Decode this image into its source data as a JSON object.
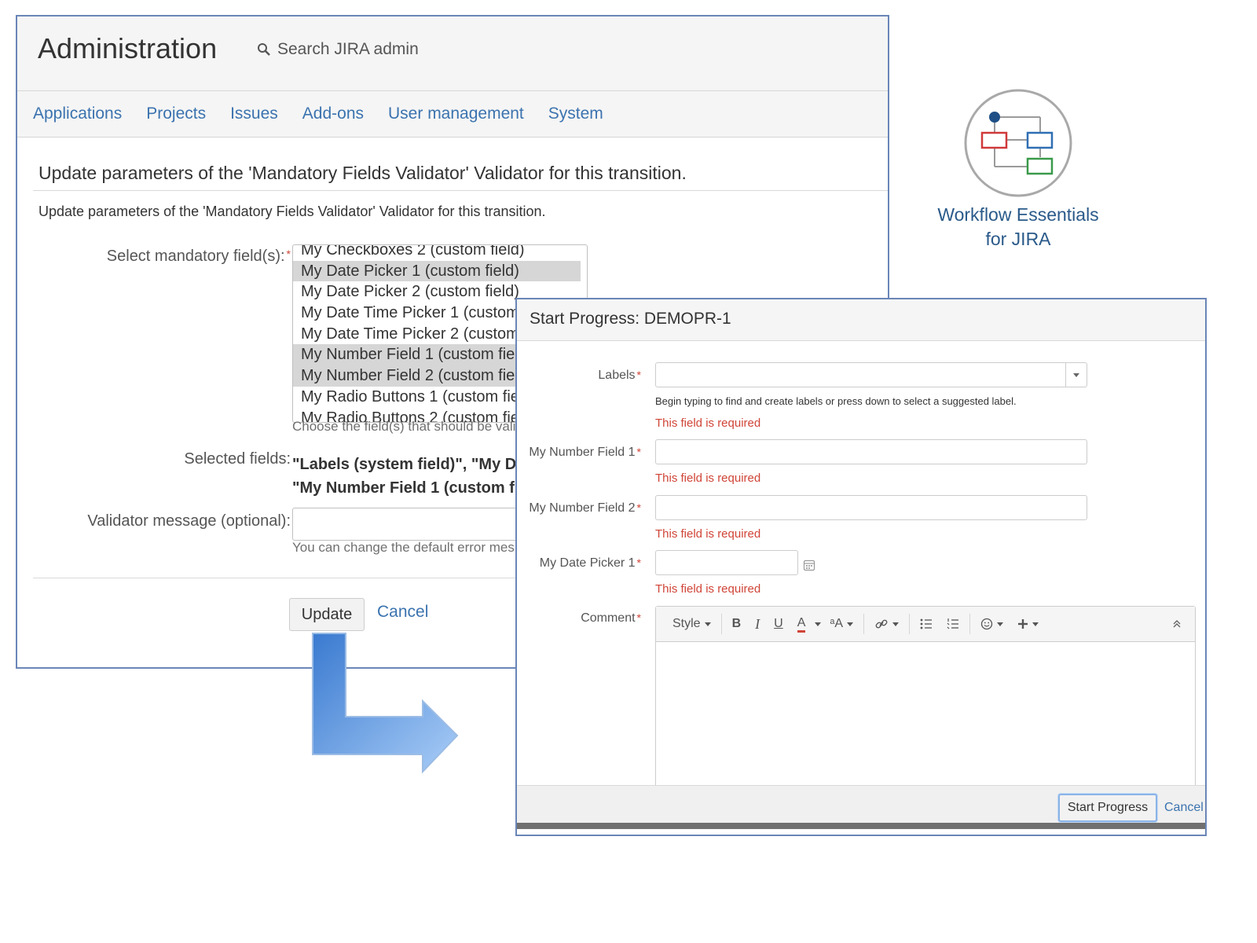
{
  "admin": {
    "title": "Administration",
    "search_placeholder": "Search JIRA admin",
    "nav": [
      "Applications",
      "Projects",
      "Issues",
      "Add-ons",
      "User management",
      "System"
    ],
    "section_title": "Update parameters of the 'Mandatory Fields Validator' Validator for this transition.",
    "section_desc": "Update parameters of the 'Mandatory Fields Validator' Validator for this transition.",
    "select_label": "Select mandatory field(s):",
    "required_mark": "*",
    "options": [
      {
        "label": "My Checkboxes 2 (custom field)",
        "selected": false
      },
      {
        "label": "My Date Picker 1 (custom field)",
        "selected": true
      },
      {
        "label": "My Date Picker 2 (custom field)",
        "selected": false
      },
      {
        "label": "My Date Time Picker 1 (custom",
        "selected": false
      },
      {
        "label": "My Date Time Picker 2 (custom",
        "selected": false
      },
      {
        "label": "My Number Field 1 (custom fiel",
        "selected": true
      },
      {
        "label": "My Number Field 2 (custom fiel",
        "selected": true
      },
      {
        "label": "My Radio Buttons 1 (custom fie",
        "selected": false
      },
      {
        "label": "My Radio Buttons 2 (custom fie",
        "selected": false
      }
    ],
    "select_help": "Choose the field(s) that should be vali",
    "selected_label": "Selected fields:",
    "selected_line1": "\"Labels (system field)\", \"My Da",
    "selected_line2": "\"My Number Field 1 (custom fi",
    "message_label": "Validator message (optional):",
    "message_value": "",
    "message_help": "You can change the default error mes",
    "update_button": "Update",
    "cancel_link": "Cancel"
  },
  "logo": {
    "line1": "Workflow Essentials",
    "line2": "for JIRA"
  },
  "dialog": {
    "title": "Start Progress:  DEMOPR-1",
    "required_mark": "*",
    "labels_label": "Labels",
    "labels_value": "",
    "labels_help": "Begin typing to find and create labels or press down to select a suggested label.",
    "error_text": "This field is required",
    "number1_label": "My Number Field 1",
    "number1_value": "",
    "number2_label": "My Number Field 2",
    "number2_value": "",
    "date_label": "My Date Picker 1",
    "date_value": "",
    "comment_label": "Comment",
    "toolbar": {
      "style": "Style",
      "bold": "B",
      "italic": "I",
      "underline": "U",
      "color": "A",
      "size": "ᵃA"
    },
    "submit_button": "Start Progress",
    "cancel_link": "Cancel"
  }
}
